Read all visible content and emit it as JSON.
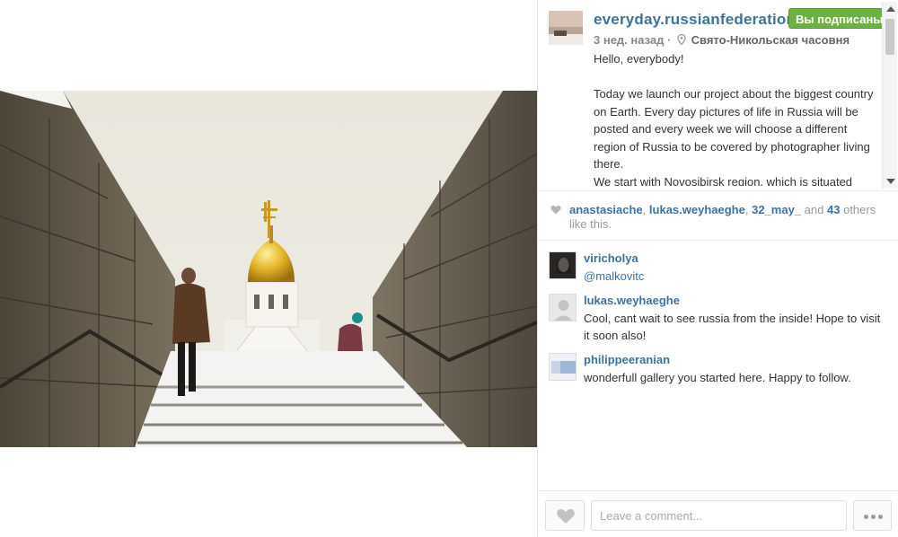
{
  "post": {
    "owner": "everyday.russianfederation",
    "follow_label": "Вы подписаны",
    "time_ago": "3 нед. назад",
    "separator": "·",
    "location": "Свято-Никольская часовня",
    "caption": "Hello, everybody!\n\nToday we launch our project about the biggest country on Earth. Every day pictures of life in Russia will be posted and every week we will choose a different region of Russia to be covered by photographer living there.\nWe start with Novosibirsk region, which is situated"
  },
  "likes": {
    "users": [
      "anastasiache",
      "lukas.weyhaeghe",
      "32_may_"
    ],
    "and_label": "and",
    "others_count": "43",
    "others_label": "others like this."
  },
  "comments": [
    {
      "user": "viricholya",
      "text": "@malkovitc"
    },
    {
      "user": "lukas.weyhaeghe",
      "text": "Cool, cant wait to see russia from the inside! Hope to visit it soon also!"
    },
    {
      "user": "philippeeranian",
      "text": "wonderfull gallery you started here. Happy to follow."
    }
  ],
  "footer": {
    "comment_placeholder": "Leave a comment..."
  },
  "icons": {
    "like": "heart-icon",
    "more": "ellipsis-icon",
    "location": "pin-icon"
  },
  "colors": {
    "link": "#3f729b",
    "follow_bg": "#6bb241"
  }
}
